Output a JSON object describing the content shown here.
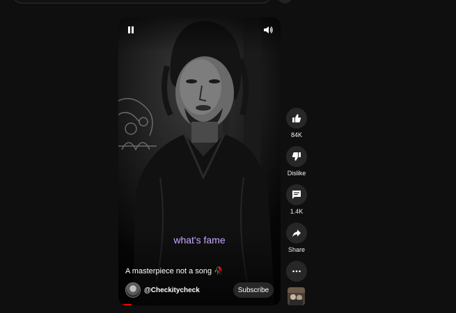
{
  "header": {
    "search_placeholder": ""
  },
  "player": {
    "caption": "what's fame",
    "title": "A masterpiece not a song 🥀",
    "channel": "@Checkitycheck",
    "subscribe_label": "Subscribe",
    "progress": 0.08,
    "icons": {
      "pause": "pause-icon",
      "volume": "volume-icon"
    }
  },
  "actions": {
    "like_count": "84K",
    "dislike_label": "Dislike",
    "comment_count": "1.4K",
    "share_label": "Share"
  },
  "colors": {
    "background": "#0f0f0f",
    "caption": "#c8a8ff",
    "progress": "#ff0000",
    "button_bg": "#272727"
  }
}
